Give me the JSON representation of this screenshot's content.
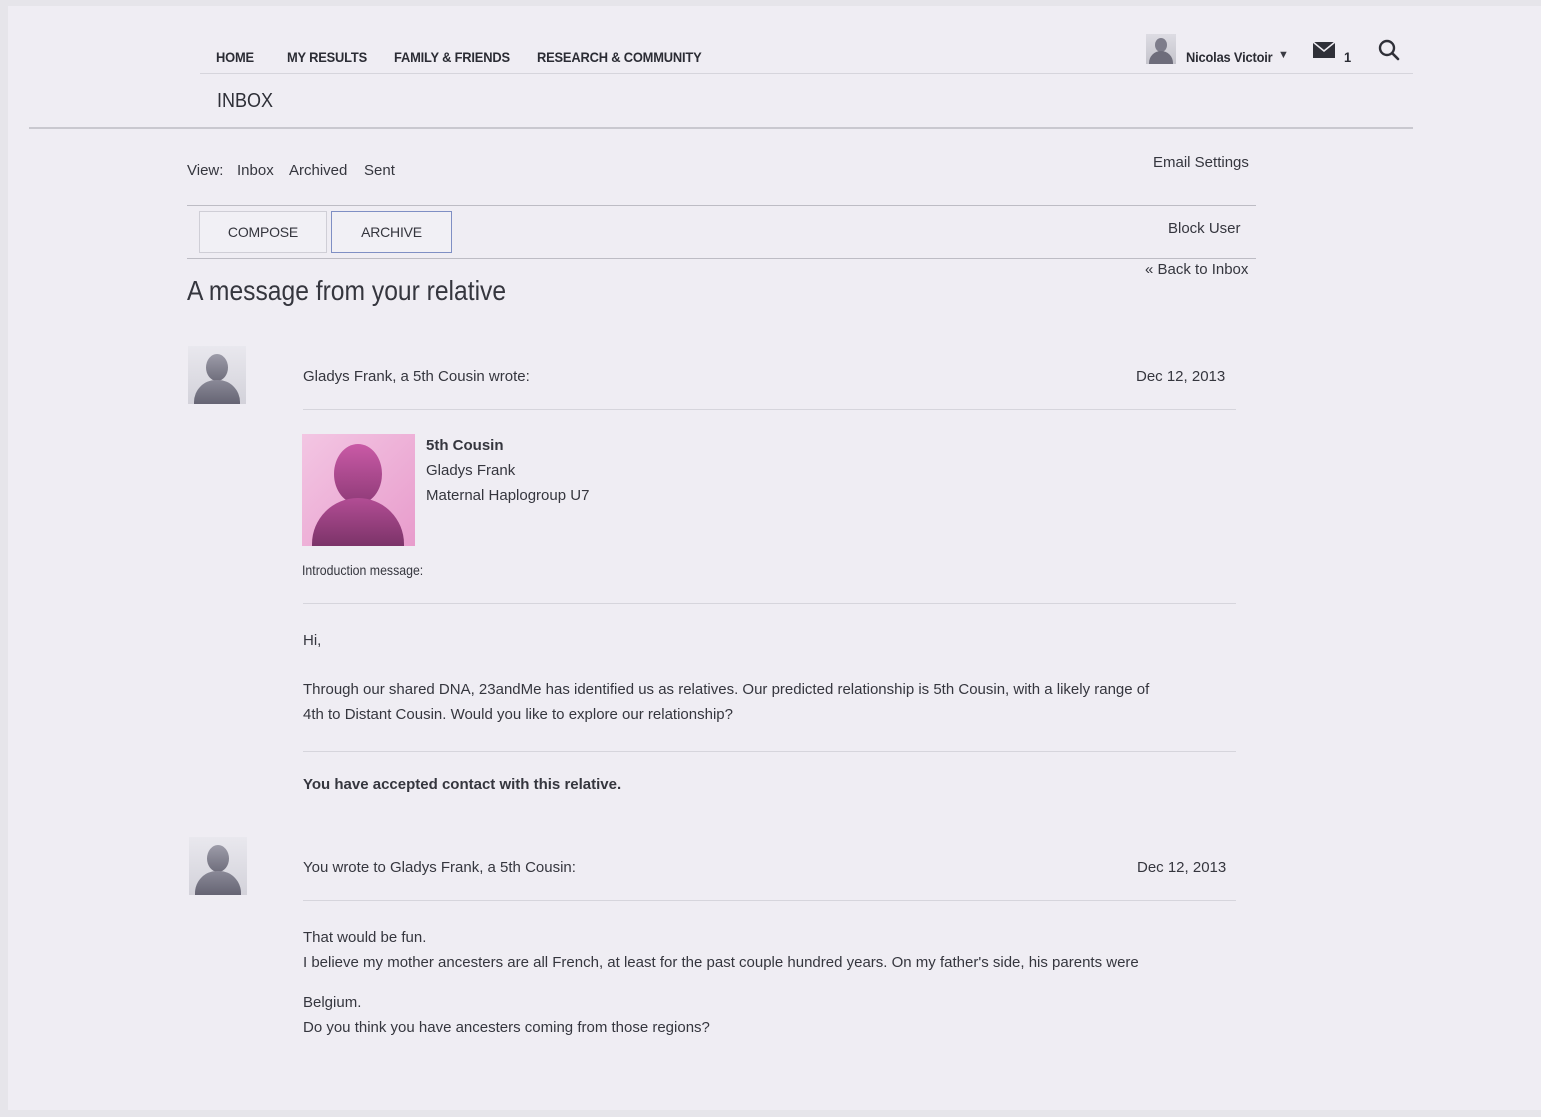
{
  "nav": {
    "items": [
      "HOME",
      "MY RESULTS",
      "FAMILY & FRIENDS",
      "RESEARCH & COMMUNITY"
    ],
    "user_name": "Nicolas Victoir",
    "mail_count": "1"
  },
  "page_heading": "INBOX",
  "view": {
    "label": "View:",
    "links": [
      "Inbox",
      "Archived",
      "Sent"
    ],
    "email_settings": "Email Settings"
  },
  "toolbar": {
    "compose": "COMPOSE",
    "archive": "ARCHIVE",
    "block_user": "Block User",
    "back": "« Back to Inbox"
  },
  "message_title": "A message from your relative",
  "messages": [
    {
      "header": "Gladys Frank, a 5th Cousin wrote:",
      "date": "Dec 12, 2013",
      "profile": {
        "relationship": "5th Cousin",
        "name": "Gladys Frank",
        "haplogroup": "Maternal Haplogroup U7"
      },
      "intro_label": "Introduction message:",
      "greeting": "Hi,",
      "body_line1": "Through our shared DNA, 23andMe has identified us as relatives. Our predicted relationship is 5th Cousin, with a likely range of",
      "body_line2": "4th to Distant Cousin. Would you like to explore our relationship?",
      "status": "You have accepted contact with this relative."
    },
    {
      "header": "You wrote to Gladys Frank, a 5th Cousin:",
      "date": "Dec 12, 2013",
      "line1": "That would be fun.",
      "line2": "I believe my mother ancesters are all French, at least for the past couple hundred years. On my father's side, his parents were",
      "line3": "Belgium.",
      "line4": "Do you think you have ancesters coming from those regions?"
    }
  ],
  "colors": {
    "background": "#efedf3",
    "active_border": "#7f8fc4",
    "profile_pink": "#e07bc0"
  }
}
